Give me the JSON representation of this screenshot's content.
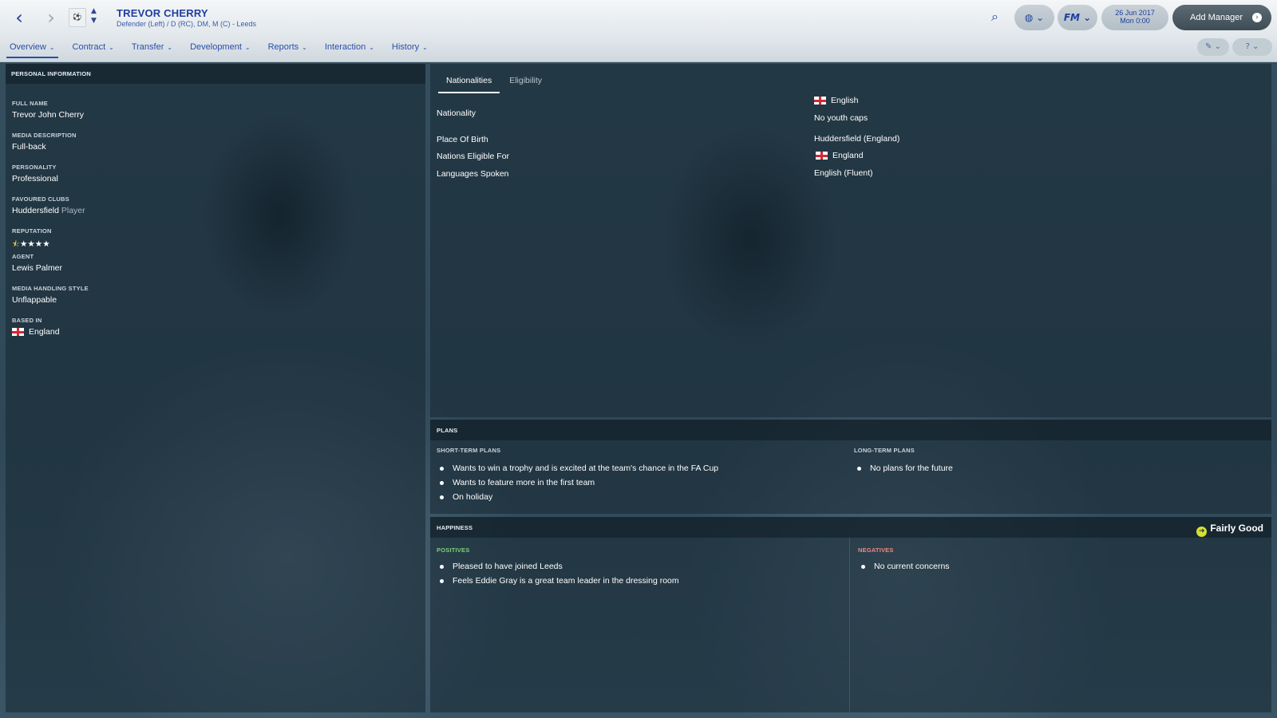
{
  "header": {
    "player_name": "TREVOR CHERRY",
    "player_sub": "Defender (Left) / D (RC), DM, M (C) - Leeds",
    "date_line1": "26 Jun 2017",
    "date_line2": "Mon 0:00",
    "add_manager": "Add Manager",
    "back_icon": "back-arrow-icon",
    "forward_icon": "forward-arrow-icon",
    "search_icon": "search-icon"
  },
  "menu": [
    {
      "label": "Overview",
      "active": true
    },
    {
      "label": "Contract"
    },
    {
      "label": "Transfer"
    },
    {
      "label": "Development"
    },
    {
      "label": "Reports"
    },
    {
      "label": "Interaction"
    },
    {
      "label": "History"
    }
  ],
  "personal": {
    "heading": "PERSONAL INFORMATION",
    "full_name_label": "FULL NAME",
    "full_name": "Trevor John Cherry",
    "media_desc_label": "MEDIA DESCRIPTION",
    "media_desc": "Full-back",
    "personality_label": "PERSONALITY",
    "personality": "Professional",
    "fav_clubs_label": "FAVOURED CLUBS",
    "fav_club": "Huddersfield",
    "fav_club_role": "Player",
    "reputation_label": "REPUTATION",
    "reputation_stars": 0.5,
    "reputation_max": 5,
    "agent_label": "AGENT",
    "agent": "Lewis Palmer",
    "media_style_label": "MEDIA HANDLING STYLE",
    "media_style": "Unflappable",
    "based_in_label": "BASED IN",
    "based_in": "England"
  },
  "nationality_tabs": [
    {
      "label": "Nationalities",
      "active": true
    },
    {
      "label": "Eligibility"
    }
  ],
  "nationality": {
    "nationality_label": "Nationality",
    "nationality_value": "English",
    "youth_caps": "No youth caps",
    "place_of_birth_label": "Place Of Birth",
    "place_of_birth": "Huddersfield (England)",
    "eligible_label": "Nations Eligible For",
    "eligible": "England",
    "languages_label": "Languages Spoken",
    "languages": "English (Fluent)"
  },
  "plans": {
    "heading": "PLANS",
    "short_label": "SHORT-TERM PLANS",
    "long_label": "LONG-TERM PLANS",
    "short": [
      "Wants to win a trophy and is excited at the team's chance in the FA Cup",
      "Wants to feature more in the first team",
      "On holiday"
    ],
    "long": [
      "No plans for the future"
    ]
  },
  "happiness": {
    "heading": "HAPPINESS",
    "status": "Fairly Good",
    "positives_label": "POSITIVES",
    "negatives_label": "NEGATIVES",
    "positives": [
      "Pleased to have joined Leeds",
      "Feels Eddie Gray is a great team leader in the dressing room"
    ],
    "negatives": [
      "No current concerns"
    ]
  },
  "colors": {
    "accent_blue": "#1d3fa0",
    "positive_green": "#7ed07a",
    "negative_red": "#ee8a80",
    "status_yellow": "#d8e030"
  }
}
